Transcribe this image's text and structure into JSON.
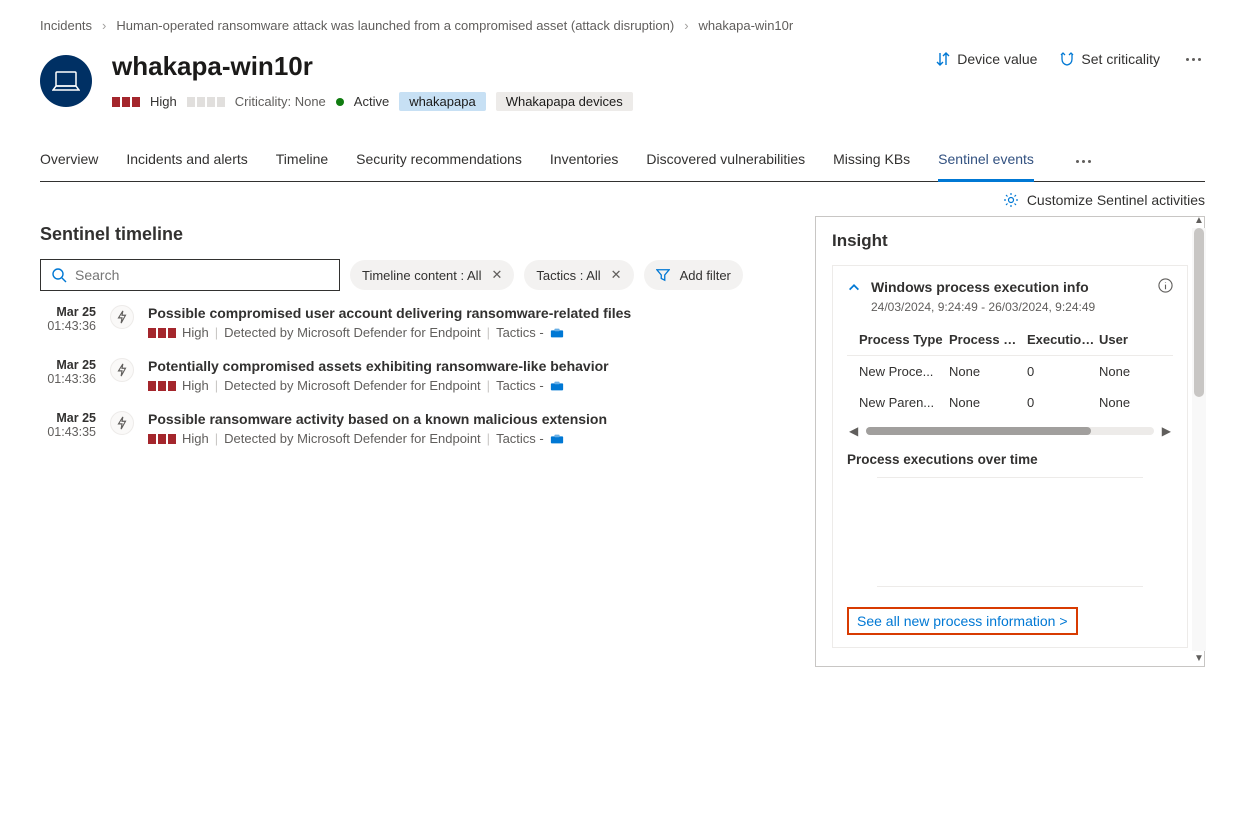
{
  "breadcrumb": {
    "l1": "Incidents",
    "l2": "Human-operated ransomware attack was launched from a compromised asset (attack disruption)",
    "l3": "whakapa-win10r"
  },
  "header": {
    "title": "whakapa-win10r",
    "severity_label": "High",
    "criticality_label": "Criticality: None",
    "status_label": "Active",
    "tags": {
      "user": "whakapapa",
      "group": "Whakapapa devices"
    },
    "actions": {
      "device_value": "Device value",
      "set_criticality": "Set criticality"
    }
  },
  "tabs": {
    "t0": "Overview",
    "t1": "Incidents and alerts",
    "t2": "Timeline",
    "t3": "Security recommendations",
    "t4": "Inventories",
    "t5": "Discovered vulnerabilities",
    "t6": "Missing KBs",
    "t7": "Sentinel events"
  },
  "toolbar": {
    "customize": "Customize Sentinel activities"
  },
  "timeline": {
    "heading": "Sentinel timeline",
    "search_placeholder": "Search",
    "filter_content": "Timeline content : All",
    "filter_tactics": "Tactics : All",
    "add_filter": "Add filter",
    "events": [
      {
        "date": "Mar 25",
        "time": "01:43:36",
        "title": "Possible compromised user account delivering ransomware-related files",
        "sev": "High",
        "detected": "Detected by Microsoft Defender for Endpoint",
        "tactics": "Tactics -"
      },
      {
        "date": "Mar 25",
        "time": "01:43:36",
        "title": "Potentially compromised assets exhibiting ransomware-like behavior",
        "sev": "High",
        "detected": "Detected by Microsoft Defender for Endpoint",
        "tactics": "Tactics -"
      },
      {
        "date": "Mar 25",
        "time": "01:43:35",
        "title": "Possible ransomware activity based on a known malicious extension",
        "sev": "High",
        "detected": "Detected by Microsoft Defender for Endpoint",
        "tactics": "Tactics -"
      }
    ]
  },
  "insight": {
    "heading": "Insight",
    "card_title": "Windows process execution info",
    "card_range": "24/03/2024, 9:24:49 - 26/03/2024, 9:24:49",
    "columns": {
      "c0": "Process Type",
      "c1": "Process Na...",
      "c2": "Executions",
      "c3": "User"
    },
    "rows": [
      {
        "c0": "New Proce...",
        "c1": "None",
        "c2": "0",
        "c3": "None"
      },
      {
        "c0": "New Paren...",
        "c1": "None",
        "c2": "0",
        "c3": "None"
      }
    ],
    "chart_title": "Process executions over time",
    "see_all": "See all new process information >"
  }
}
